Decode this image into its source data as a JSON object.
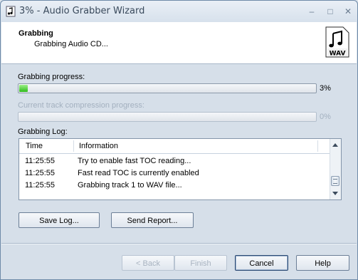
{
  "window": {
    "title": "3% - Audio Grabber Wizard"
  },
  "header": {
    "title": "Grabbing",
    "subtitle": "Grabbing Audio CD...",
    "icon": "wav-file-icon",
    "icon_text": "WAV"
  },
  "grabbing": {
    "label": "Grabbing progress:",
    "percent_text": "3%",
    "fraction": 0.03
  },
  "compression": {
    "label": "Current track compression progress:",
    "percent_text": "0%",
    "fraction": 0
  },
  "log": {
    "label": "Grabbing Log:",
    "columns": [
      "Time",
      "Information"
    ],
    "rows": [
      {
        "time": "11:25:55",
        "info": "Try to enable fast TOC reading..."
      },
      {
        "time": "11:25:55",
        "info": "Fast read TOC is currently enabled"
      },
      {
        "time": "11:25:55",
        "info": "Grabbing track 1 to WAV file..."
      }
    ]
  },
  "actions": {
    "save_log": "Save Log...",
    "send_report": "Send Report..."
  },
  "footer": {
    "back": "< Back",
    "finish": "Finish",
    "cancel": "Cancel",
    "help": "Help"
  },
  "colors": {
    "progress_fill": "#2ebb1b",
    "window_bg": "#d6dfe9"
  }
}
